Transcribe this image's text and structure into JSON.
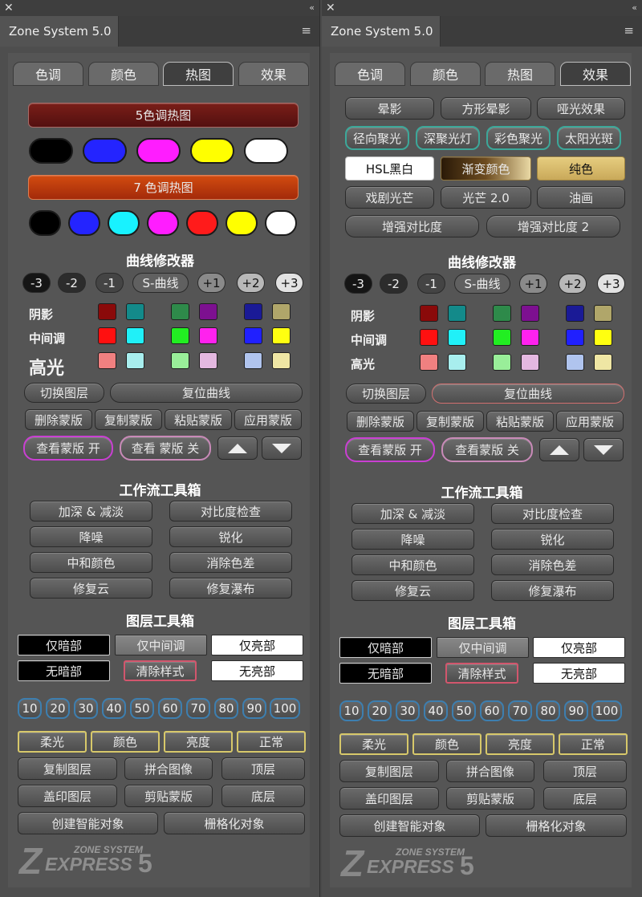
{
  "panel": {
    "title": "Zone System 5.0"
  },
  "tabs": [
    "色调",
    "颜色",
    "热图",
    "效果"
  ],
  "heatmap": {
    "five_btn": "5色调热图",
    "five_colors": [
      "#000000",
      "#2424ff",
      "#ff1dff",
      "#ffff00",
      "#ffffff"
    ],
    "seven_btn": "7 色调热图",
    "seven_colors": [
      "#000000",
      "#2424ff",
      "#18f2ff",
      "#ff1dff",
      "#ff1b1b",
      "#ffff00",
      "#ffffff"
    ]
  },
  "effects": {
    "row1": [
      "晕影",
      "方形晕影",
      "哑光效果"
    ],
    "row2": [
      "径向聚光",
      "深聚光灯",
      "彩色聚光",
      "太阳光斑"
    ],
    "row3": [
      "HSL黑白",
      "渐变颜色",
      "纯色"
    ],
    "row4": [
      "戏剧光芒",
      "光芒 2.0",
      "油画"
    ],
    "row5": [
      "增强对比度",
      "增强对比度 2"
    ]
  },
  "curves": {
    "title": "曲线修改器",
    "buttons": [
      "-3",
      "-2",
      "-1",
      "S-曲线",
      "+1",
      "+2",
      "+3"
    ],
    "shadow": "阴影",
    "mid": "中间调",
    "high": "高光",
    "shadow_colors": [
      "#8a0a0a",
      "#138a8a",
      "#2e8a4a",
      "#7d1090",
      "#1a1a96",
      "#b0a66a"
    ],
    "mid_colors": [
      "#ff1010",
      "#20f0f8",
      "#22ee22",
      "#ff22ee",
      "#2020ff",
      "#ffff10"
    ],
    "high_colors": [
      "#f08080",
      "#a8eeee",
      "#99ee99",
      "#e4b8e0",
      "#b0c4ee",
      "#efe6a4"
    ],
    "switch_layer": "切换图层",
    "reset_curve": "复位曲线"
  },
  "mask": {
    "row1": [
      "删除蒙版",
      "复制蒙版",
      "粘贴蒙版",
      "应用蒙版"
    ],
    "view_on": "查看蒙版 开",
    "view_off_left": "查看 蒙版 关",
    "view_off_right": "查看蒙版 关"
  },
  "workflow": {
    "title": "工作流工具箱",
    "items": [
      "加深 & 减淡",
      "对比度检查",
      "降噪",
      "锐化",
      "中和颜色",
      "消除色差",
      "修复云",
      "修复瀑布"
    ]
  },
  "layers": {
    "title": "图层工具箱",
    "dark_only": "仅暗部",
    "mid_only": "仅中间调",
    "light_only": "仅亮部",
    "no_dark": "无暗部",
    "clear_style": "清除样式",
    "no_light": "无亮部",
    "opacity": [
      "10",
      "20",
      "30",
      "40",
      "50",
      "60",
      "70",
      "80",
      "90",
      "100"
    ],
    "blend": [
      "柔光",
      "颜色",
      "亮度",
      "正常"
    ],
    "row_a": [
      "复制图层",
      "拼合图像",
      "顶层"
    ],
    "row_b": [
      "盖印图层",
      "剪贴蒙版",
      "底层"
    ],
    "row_c": [
      "创建智能对象",
      "栅格化对象"
    ]
  },
  "logo": {
    "top": "ZONE SYSTEM",
    "main": "EXPRESS",
    "z": "Z",
    "num": "5"
  }
}
